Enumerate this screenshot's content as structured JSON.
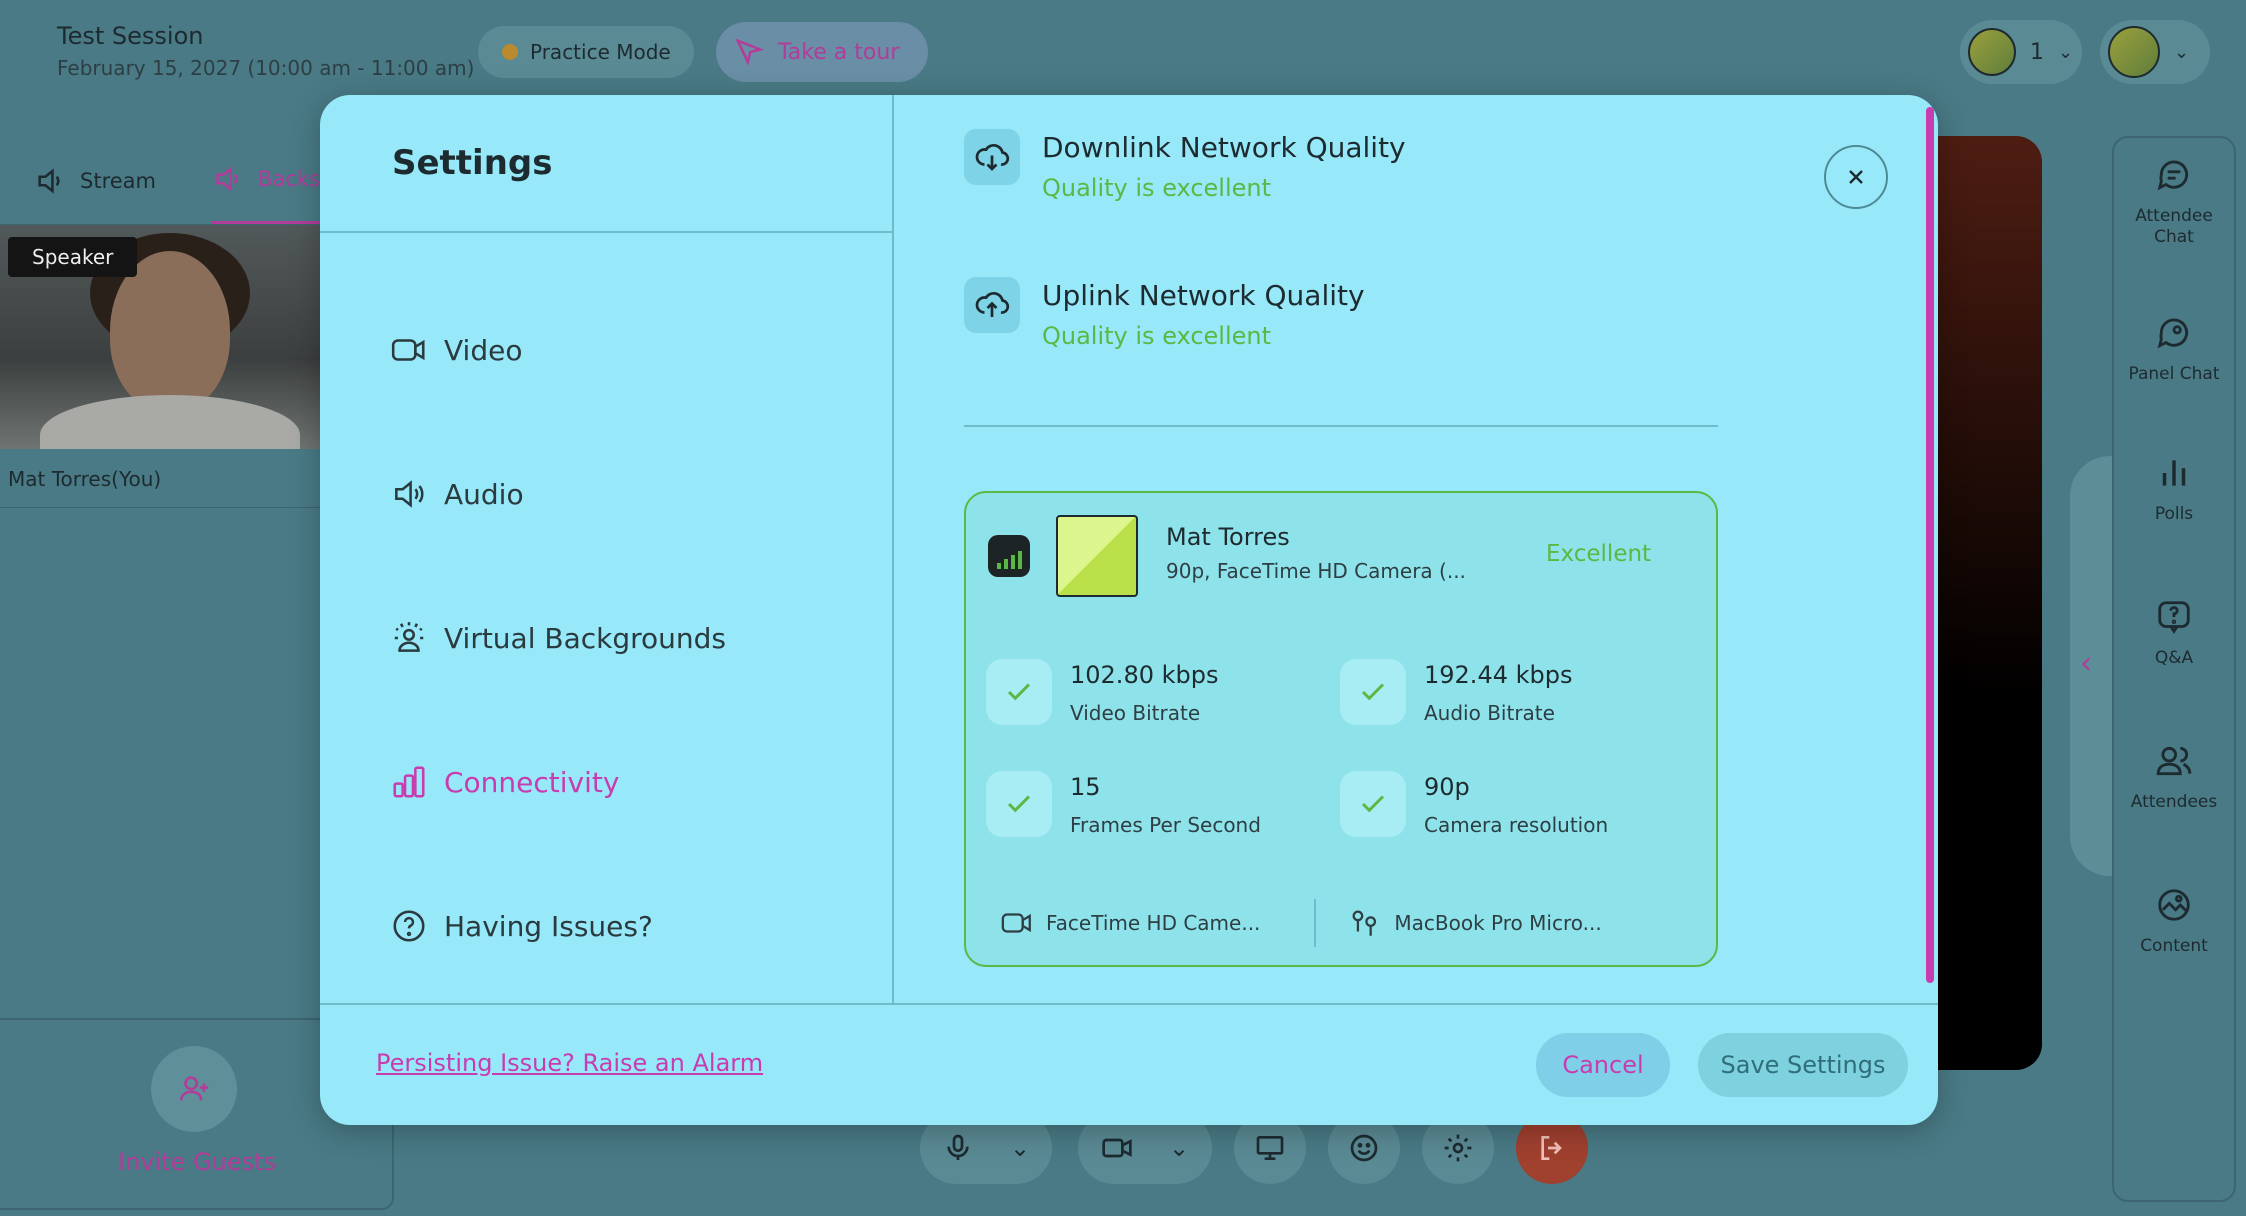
{
  "session": {
    "title": "Test Session",
    "date": "February 15, 2027 (10:00 am - 11:00 am)",
    "practice_mode": "Practice Mode",
    "take_tour": "Take a tour",
    "participant_count": "1"
  },
  "left_panel": {
    "tabs": [
      {
        "label": "Stream"
      },
      {
        "label": "Backs"
      }
    ],
    "speaker_badge": "Speaker",
    "speaker_name": "Mat Torres(You)",
    "invite_label": "Invite Guests"
  },
  "right_rail": {
    "items": [
      {
        "label": "Attendee Chat",
        "icon": "chat-icon"
      },
      {
        "label": "Panel Chat",
        "icon": "panel-chat-icon"
      },
      {
        "label": "Polls",
        "icon": "polls-icon"
      },
      {
        "label": "Q&A",
        "icon": "qa-icon"
      },
      {
        "label": "Attendees",
        "icon": "attendees-icon"
      },
      {
        "label": "Content",
        "icon": "content-icon"
      }
    ]
  },
  "modal": {
    "title": "Settings",
    "nav": [
      {
        "label": "Video",
        "icon": "video-icon"
      },
      {
        "label": "Audio",
        "icon": "speaker-icon"
      },
      {
        "label": "Virtual Backgrounds",
        "icon": "background-icon"
      },
      {
        "label": "Connectivity",
        "icon": "bar-chart-icon",
        "active": true
      },
      {
        "label": "Having Issues?",
        "icon": "help-icon"
      }
    ],
    "downlink": {
      "title": "Downlink Network Quality",
      "status": "Quality is excellent"
    },
    "uplink": {
      "title": "Uplink Network Quality",
      "status": "Quality is excellent"
    },
    "card": {
      "name": "Mat Torres",
      "subtitle": "90p, FaceTime HD Camera (...",
      "quality": "Excellent",
      "metrics": [
        {
          "value": "102.80 kbps",
          "label": "Video Bitrate"
        },
        {
          "value": "192.44 kbps",
          "label": "Audio Bitrate"
        },
        {
          "value": "15",
          "label": "Frames Per Second"
        },
        {
          "value": "90p",
          "label": "Camera resolution"
        }
      ],
      "camera_device": "FaceTime HD Came...",
      "mic_device": "MacBook Pro Micro..."
    },
    "alarm_link": "Persisting Issue? Raise an Alarm",
    "cancel": "Cancel",
    "save": "Save Settings"
  },
  "colors": {
    "accent": "#c93cb0",
    "success": "#5bb844",
    "modal_bg": "#97e8f8",
    "backdrop": "#497a85"
  }
}
